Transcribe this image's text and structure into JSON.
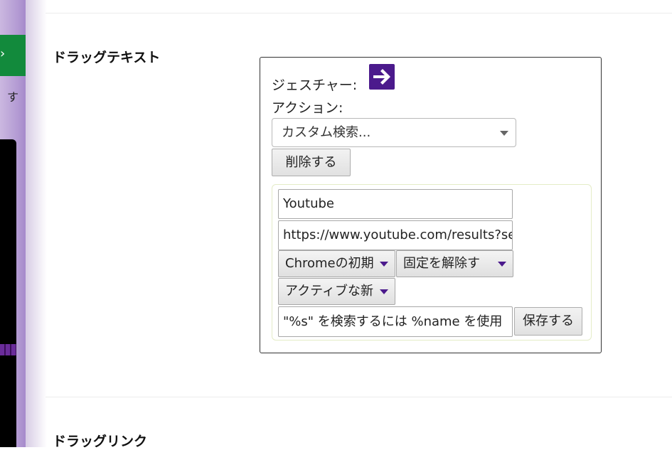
{
  "sidebar": {
    "partial_text": "す"
  },
  "sections": [
    {
      "heading": "ドラッグテキスト"
    },
    {
      "heading": "ドラッグリンク"
    }
  ],
  "gesture_card": {
    "gesture_label": "ジェスチャー:",
    "gesture_icon": "arrow-right-icon",
    "action_label": "アクション:",
    "action_selected": "カスタム検索...",
    "delete_label": "削除する",
    "custom_search": {
      "name_value": "Youtube",
      "url_value": "https://www.youtube.com/results?sea",
      "engine_select": "Chromeの初期",
      "pin_select": "固定を解除す",
      "tab_select": "アクティブな新",
      "description_value": "\"%s\" を検索するには %name を使用",
      "save_label": "保存する"
    }
  },
  "colors": {
    "accent_purple": "#4b1a8c",
    "sidebar_green": "#128a3c"
  }
}
